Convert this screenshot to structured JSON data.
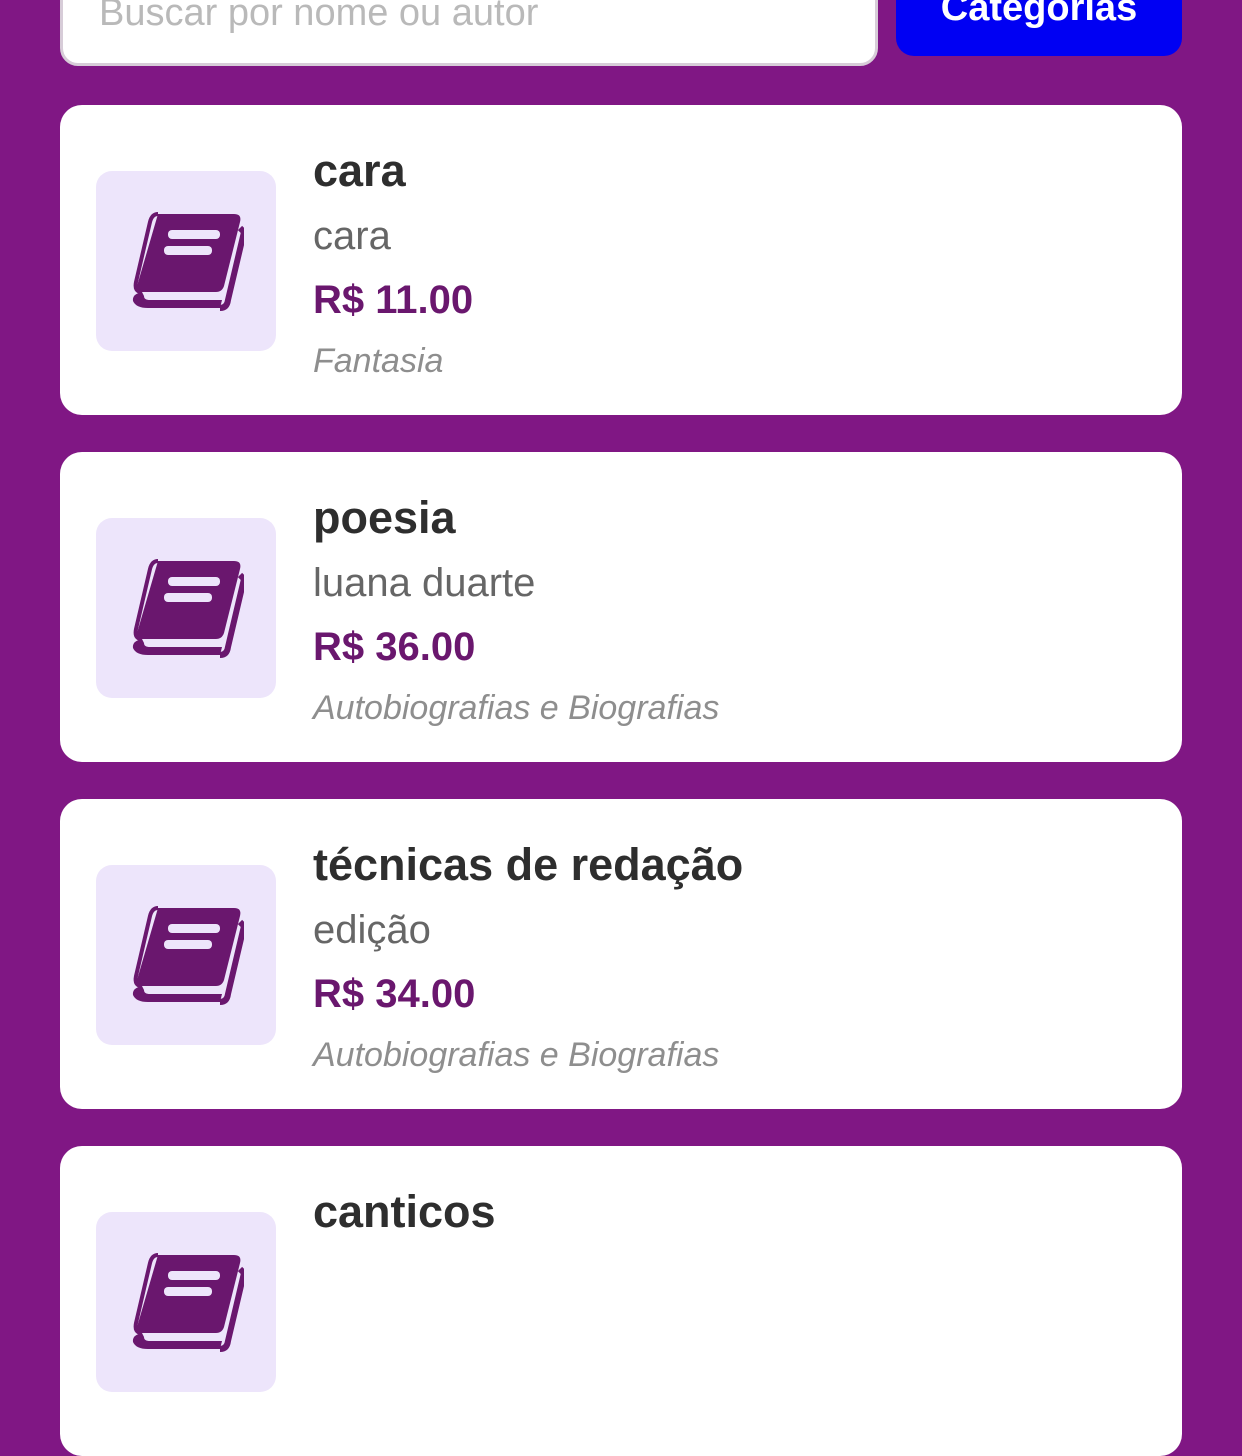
{
  "search": {
    "placeholder": "Buscar por nome ou autor",
    "value": ""
  },
  "toolbar": {
    "categories_label": "Categorias"
  },
  "icons": {
    "book": "book-icon"
  },
  "colors": {
    "background": "#801784",
    "card": "#ffffff",
    "thumb_background": "#ede5fb",
    "icon": "#6a176e",
    "price": "#6a176e",
    "categories_button": "#0000f3"
  },
  "books": [
    {
      "title": "cara",
      "author": "cara",
      "price": "R$ 11.00",
      "category": "Fantasia"
    },
    {
      "title": "poesia",
      "author": "luana duarte",
      "price": "R$ 36.00",
      "category": "Autobiografias e Biografias"
    },
    {
      "title": "técnicas de redação",
      "author": "edição",
      "price": "R$ 34.00",
      "category": "Autobiografias e Biografias"
    },
    {
      "title": "canticos",
      "author": "",
      "price": "",
      "category": ""
    }
  ]
}
